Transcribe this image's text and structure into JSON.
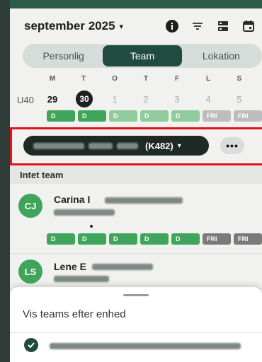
{
  "header": {
    "month": "september 2025",
    "caret": "▾",
    "icons": [
      "info-icon",
      "filter-icon",
      "layout-icon",
      "calendar-icon"
    ]
  },
  "tabs": [
    {
      "label": "Personlig",
      "active": false
    },
    {
      "label": "Team",
      "active": true
    },
    {
      "label": "Lokation",
      "active": false
    }
  ],
  "calendar": {
    "weekdays": [
      "M",
      "T",
      "O",
      "T",
      "F",
      "L",
      "S"
    ],
    "week_label": "U40",
    "days": [
      "29",
      "30",
      "1",
      "2",
      "3",
      "4",
      "5"
    ],
    "today": "30",
    "summary_chips": [
      "D",
      "D",
      "D",
      "D",
      "D",
      "FRI",
      "FRI"
    ]
  },
  "team_selector": {
    "code": "(K482)",
    "caret": "▾",
    "more_label": "•••"
  },
  "section": {
    "title": "Intet team"
  },
  "people": [
    {
      "initials": "CJ",
      "name": "Carina I",
      "chips": [
        "D",
        "D",
        "D",
        "D",
        "D",
        "FRI",
        "FRI"
      ]
    },
    {
      "initials": "LS",
      "name": "Lene E"
    }
  ],
  "sheet": {
    "title": "Vis teams efter enhed"
  },
  "colors": {
    "accent": "#1f4c3f",
    "shift": "#3fa55a",
    "highlight": "#e3121b"
  }
}
